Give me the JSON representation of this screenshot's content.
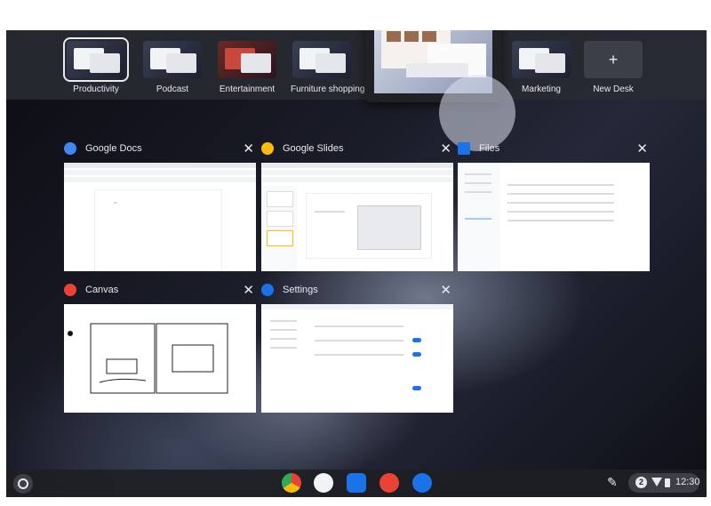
{
  "desks": [
    {
      "label": "Productivity",
      "active": true
    },
    {
      "label": "Podcast",
      "active": false
    },
    {
      "label": "Entertainment",
      "active": false
    },
    {
      "label": "Furniture shopping",
      "active": false
    },
    {
      "label": "Marketing",
      "active": false
    }
  ],
  "new_desk": {
    "label": "New Desk",
    "icon": "+"
  },
  "windows": [
    {
      "title": "Google Docs",
      "icon": "google-docs-icon",
      "color": "#4285f4"
    },
    {
      "title": "Google Slides",
      "icon": "google-slides-icon",
      "color": "#fbbc04"
    },
    {
      "title": "Files",
      "icon": "files-icon",
      "color": "#1a73e8"
    },
    {
      "title": "Canvas",
      "icon": "canvas-icon",
      "color": "#ea4335"
    },
    {
      "title": "Settings",
      "icon": "settings-icon",
      "color": "#1a73e8"
    }
  ],
  "close_glyph": "✕",
  "shelf": {
    "apps": [
      "chrome-icon",
      "play-store-icon",
      "files-icon",
      "canvas-icon",
      "settings-icon"
    ],
    "notification_count": "2",
    "time": "12:30"
  },
  "colors": {
    "accent": "#1a73e8",
    "shelf": "#1e1f24"
  }
}
